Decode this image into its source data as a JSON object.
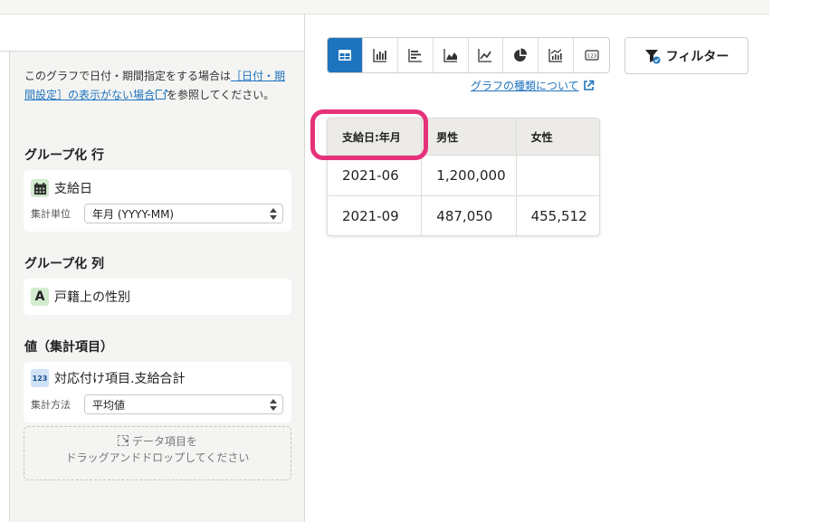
{
  "left_panel": {
    "note_text_1": "このグラフで日付・期間指定をする場合は",
    "note_link": "［日付・期間設定］の表示がない場合",
    "note_text_2": "を参照してください。",
    "group_row": {
      "title": "グループ化 行",
      "field_name": "支給日",
      "field_icon": "calendar-icon",
      "unit_label": "集計単位",
      "unit_value": "年月 (YYYY-MM)"
    },
    "group_col": {
      "title": "グループ化 列",
      "field_name": "戸籍上の性別",
      "field_icon_text": "A"
    },
    "values": {
      "title": "値（集計項目）",
      "field_name": "対応付け項目.支給合計",
      "field_icon_text": "123",
      "method_label": "集計方法",
      "method_value": "平均値"
    },
    "dropzone": {
      "line1": "データ項目を",
      "line2": "ドラッグアンドドロップしてください"
    }
  },
  "toolbar": {
    "buttons": [
      "table-icon",
      "bar-chart-icon",
      "horizontal-bar-icon",
      "area-chart-icon",
      "line-chart-icon",
      "pie-chart-icon",
      "combo-chart-icon",
      "number-icon"
    ],
    "active": "table-icon",
    "number_icon_text": "123",
    "accent": "#1e73be"
  },
  "filter_button": {
    "label": "フィルター"
  },
  "help_link": {
    "label": "グラフの種類について"
  },
  "table": {
    "headers": [
      "支給日:年月",
      "男性",
      "女性"
    ],
    "rows": [
      [
        "2021-06",
        "1,200,000",
        ""
      ],
      [
        "2021-09",
        "487,050",
        "455,512"
      ]
    ]
  },
  "highlight_color": "#e5327a"
}
